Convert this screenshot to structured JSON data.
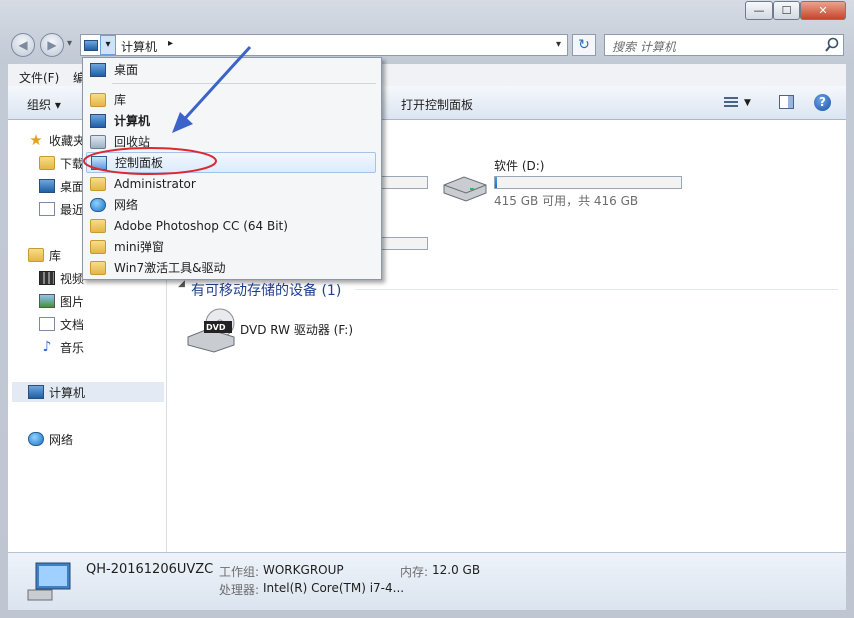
{
  "window": {
    "min_symbol": "—",
    "max_symbol": "☐",
    "close_symbol": "✕"
  },
  "nav": {
    "back_icon": "back-arrow-icon",
    "forward_icon": "forward-arrow-icon",
    "recent_arrow": "▾"
  },
  "address": {
    "crumb": "计算机",
    "separator": "▸",
    "dropdown_arrow": "▾",
    "refresh_symbol": "↻"
  },
  "search": {
    "placeholder": "搜索 计算机",
    "icon": "search-icon"
  },
  "menubar": {
    "items": [
      "文件(F)",
      "编"
    ]
  },
  "toolbar": {
    "organize": "组织 ▾",
    "control_panel": "打开控制面板",
    "help_symbol": "?"
  },
  "navpane": {
    "favorites": "收藏夹",
    "downloads": "下载",
    "desktop": "桌面",
    "recent": "最近",
    "libraries": "库",
    "videos": "视频",
    "pictures": "图片",
    "documents": "文档",
    "music": "音乐",
    "computer": "计算机",
    "network": "网络"
  },
  "dropdown": {
    "items": [
      {
        "label": "桌面",
        "icon": "desktop-icon"
      },
      {
        "label": "库",
        "icon": "library-icon"
      },
      {
        "label": "计算机",
        "icon": "computer-icon"
      },
      {
        "label": "回收站",
        "icon": "recycle-bin-icon"
      },
      {
        "label": "控制面板",
        "icon": "control-panel-icon"
      },
      {
        "label": "Administrator",
        "icon": "user-folder-icon"
      },
      {
        "label": "网络",
        "icon": "network-icon"
      },
      {
        "label": "Adobe Photoshop CC (64 Bit)",
        "icon": "folder-icon"
      },
      {
        "label": "mini弹窗",
        "icon": "folder-icon"
      },
      {
        "label": "Win7激活工具&驱动",
        "icon": "folder-icon"
      }
    ]
  },
  "drives": {
    "d_name": "软件 (D:)",
    "d_space": "415 GB 可用，共 416 GB",
    "d_usage_fraction": 0.0024,
    "removable_header": "有可移动存储的设备 (1)",
    "dvd_name": "DVD RW 驱动器 (F:)",
    "dvd_badge": "DVD"
  },
  "details": {
    "computer_name": "QH-20161206UVZC",
    "workgroup_label": "工作组:",
    "workgroup": "WORKGROUP",
    "memory_label": "内存:",
    "memory": "12.0 GB",
    "cpu_label": "处理器:",
    "cpu": "Intel(R) Core(TM) i7-4..."
  },
  "colors": {
    "highlight_ring": "#e0272f",
    "arrow": "#3b63c9",
    "link_blue": "#1f3f8f"
  }
}
